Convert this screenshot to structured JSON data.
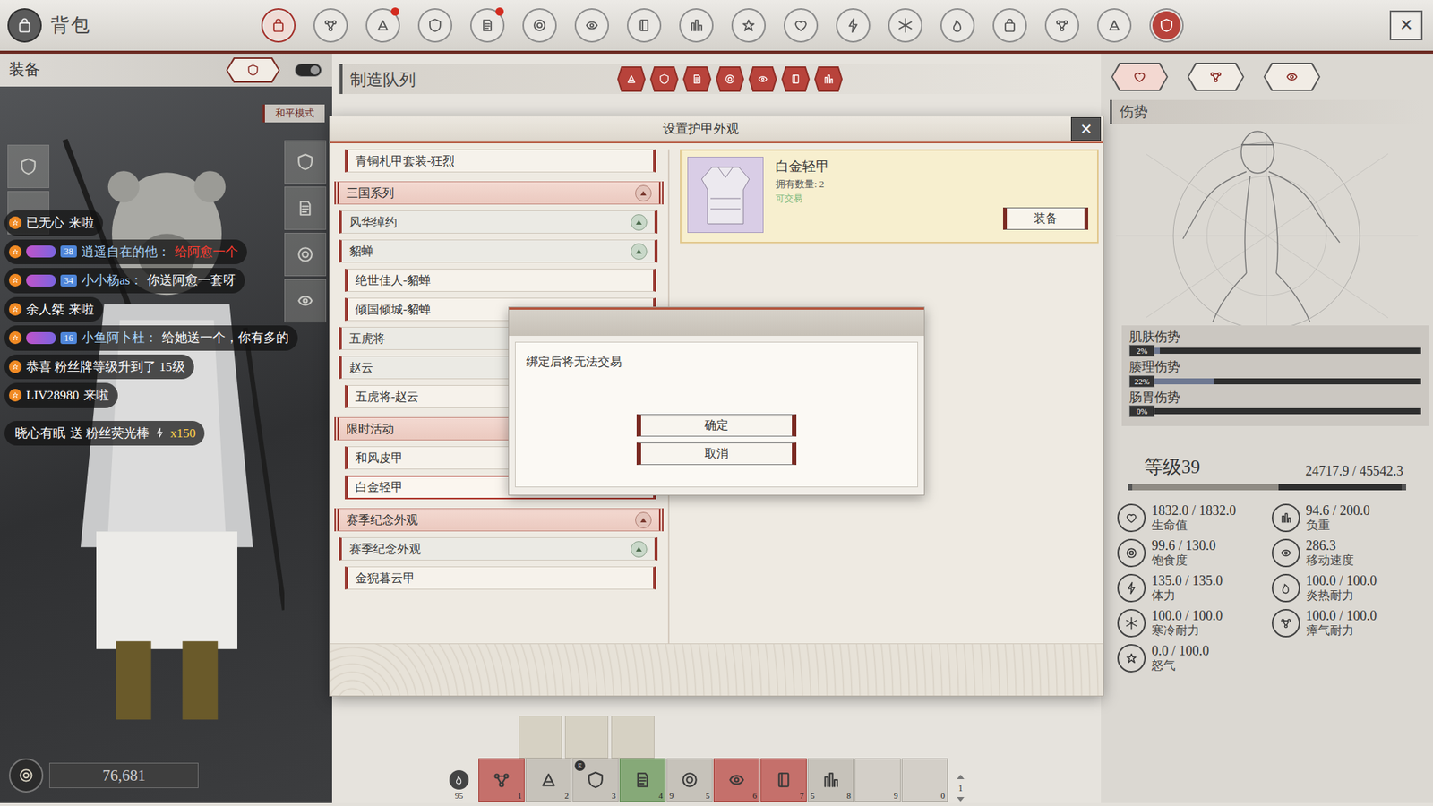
{
  "window": {
    "title": "背包",
    "close": "✕"
  },
  "top_tabs": [
    {
      "selected": true,
      "alert": false,
      "accent": false
    },
    {
      "selected": false,
      "alert": false,
      "accent": false
    },
    {
      "selected": false,
      "alert": true,
      "accent": false
    },
    {
      "selected": false,
      "alert": false,
      "accent": false
    },
    {
      "selected": false,
      "alert": true,
      "accent": false
    },
    {
      "selected": false,
      "alert": false,
      "accent": false
    },
    {
      "selected": false,
      "alert": false,
      "accent": false
    },
    {
      "selected": false,
      "alert": false,
      "accent": false
    },
    {
      "selected": false,
      "alert": false,
      "accent": false
    },
    {
      "selected": false,
      "alert": false,
      "accent": false
    },
    {
      "selected": false,
      "alert": false,
      "accent": false
    },
    {
      "selected": false,
      "alert": false,
      "accent": false
    },
    {
      "selected": false,
      "alert": false,
      "accent": false
    },
    {
      "selected": false,
      "alert": false,
      "accent": false
    },
    {
      "selected": false,
      "alert": false,
      "accent": false
    },
    {
      "selected": false,
      "alert": false,
      "accent": false
    },
    {
      "selected": false,
      "alert": false,
      "accent": false
    },
    {
      "selected": false,
      "alert": false,
      "accent": true
    }
  ],
  "equipment": {
    "title": "装备",
    "toggle_on": true,
    "mode": "和平模式",
    "left_slots": [
      {
        "filled": true
      },
      {
        "filled": false
      }
    ],
    "right_slots": [
      {
        "filled": true
      },
      {
        "filled": true
      },
      {
        "filled": true
      },
      {
        "filled": true
      }
    ]
  },
  "chat": [
    {
      "kind": "enter",
      "user": "已无心",
      "text": "来啦"
    },
    {
      "kind": "message",
      "badges": [
        "38"
      ],
      "user": "逍遥自在的他：",
      "text": "给阿愈一个",
      "color": "#ff3b2f"
    },
    {
      "kind": "message",
      "badges": [
        "34"
      ],
      "user": "小小杨as：",
      "text": "你送阿愈一套呀",
      "color": "#ffffff"
    },
    {
      "kind": "enter",
      "user": "余人桀",
      "text": "来啦"
    },
    {
      "kind": "message",
      "badges": [
        "16"
      ],
      "user": "小鱼阿卜杜：",
      "text": "给她送一个，你有多的",
      "color": "#ffffff"
    },
    {
      "kind": "notice",
      "text": "恭喜 粉丝牌等级升到了 15级"
    },
    {
      "kind": "enter",
      "user": "LIV28980",
      "text": "来啦"
    },
    {
      "kind": "gift",
      "user": "晓心有眠",
      "text": "送 粉丝荧光棒",
      "amount": "x150"
    }
  ],
  "queue": {
    "title": "制造队列"
  },
  "modal": {
    "title": "设置护甲外观",
    "close": "✕",
    "list": [
      {
        "label": "青铜札甲套装-狂烈",
        "kind": "item",
        "selected": false
      },
      {
        "label": "三国系列",
        "kind": "group",
        "selected": false
      },
      {
        "label": "风华绰约",
        "kind": "subgroup",
        "selected": false
      },
      {
        "label": "貂蝉",
        "kind": "subgroup",
        "selected": false
      },
      {
        "label": "绝世佳人-貂蝉",
        "kind": "item",
        "selected": false
      },
      {
        "label": "倾国倾城-貂蝉",
        "kind": "item",
        "selected": false
      },
      {
        "label": "五虎将",
        "kind": "subgroup",
        "selected": false
      },
      {
        "label": "赵云",
        "kind": "subgroup",
        "selected": false
      },
      {
        "label": "五虎将-赵云",
        "kind": "item",
        "selected": false
      },
      {
        "label": "限时活动",
        "kind": "group",
        "selected": false
      },
      {
        "label": "和风皮甲",
        "kind": "item",
        "selected": false
      },
      {
        "label": "白金轻甲",
        "kind": "item",
        "selected": true
      },
      {
        "label": "赛季纪念外观",
        "kind": "group",
        "selected": false
      },
      {
        "label": "赛季纪念外观",
        "kind": "subgroup",
        "selected": false
      },
      {
        "label": "金猊暮云甲",
        "kind": "item",
        "selected": false
      }
    ],
    "detail": {
      "name": "白金轻甲",
      "owned": "拥有数量: 2",
      "tradable": "可交易",
      "button": "装备"
    }
  },
  "confirm": {
    "message": "绑定后将无法交易",
    "buttons": [
      "确定",
      "取消"
    ]
  },
  "status": {
    "tabs": [
      {
        "selected": true
      },
      {
        "selected": false
      },
      {
        "selected": false
      }
    ],
    "title": "伤势",
    "injuries": [
      {
        "name": "肌肤伤势",
        "level": 0.02,
        "reading": "2%"
      },
      {
        "name": "腠理伤势",
        "level": 0.22,
        "reading": "22%"
      },
      {
        "name": "肠胃伤势",
        "level": 0,
        "reading": "0%"
      }
    ],
    "level_label": "等级39",
    "exp": {
      "reading": "24717.9 / 45542.3",
      "level": 0.543
    },
    "stats": [
      {
        "value": "1832.0 / 1832.0",
        "label": "生命值"
      },
      {
        "value": "94.6 / 200.0",
        "label": "负重"
      },
      {
        "value": "99.6 / 130.0",
        "label": "饱食度"
      },
      {
        "value": "286.3",
        "label": "移动速度"
      },
      {
        "value": "135.0 / 135.0",
        "label": "体力"
      },
      {
        "value": "100.0 / 100.0",
        "label": "炎热耐力"
      },
      {
        "value": "100.0 / 100.0",
        "label": "寒冷耐力"
      },
      {
        "value": "100.0 / 100.0",
        "label": "瘴气耐力"
      },
      {
        "value": "0.0 / 100.0",
        "label": "怒气"
      }
    ]
  },
  "wallet": {
    "amount": "76,681"
  },
  "hotbar": {
    "side_count": "95",
    "page": "1",
    "quick": [
      {
        "filled": false
      },
      {
        "filled": false
      },
      {
        "filled": false
      }
    ],
    "slots": [
      {
        "key": "1",
        "kind": "red"
      },
      {
        "key": "2",
        "kind": "plain"
      },
      {
        "key": "3",
        "kind": "plain",
        "badge": "E"
      },
      {
        "key": "4",
        "kind": "green"
      },
      {
        "key": "5",
        "kind": "plain",
        "count": "9"
      },
      {
        "key": "6",
        "kind": "red"
      },
      {
        "key": "7",
        "kind": "red"
      },
      {
        "key": "8",
        "kind": "plain",
        "count": "5"
      },
      {
        "key": "9",
        "kind": "empty"
      },
      {
        "key": "0",
        "kind": "empty"
      }
    ]
  }
}
